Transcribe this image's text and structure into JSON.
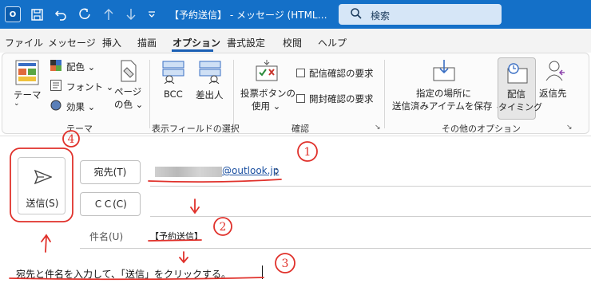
{
  "titlebar": {
    "logo": "O",
    "title": "【予約送信】 - メッセージ (HTML…",
    "search_label": "検索",
    "icons": [
      "app-logo",
      "save-icon",
      "undo-icon",
      "redo-icon",
      "up-arrow-icon",
      "down-arrow-icon",
      "dropdown-icon",
      "search-icon"
    ]
  },
  "menu": [
    "ファイル",
    "メッセージ",
    "挿入",
    "描画",
    "オプション",
    "書式設定",
    "校閲",
    "ヘルプ"
  ],
  "ribbon": {
    "theme": "テーマ",
    "colors": "配色",
    "fonts": "フォント",
    "effects": "効果",
    "page_color_1": "ページ",
    "page_color_2": "の色",
    "bcc": "BCC",
    "from": "差出人",
    "voting_1": "投票ボタンの",
    "voting_2": "使用",
    "delivery_receipt": "配信確認の要求",
    "read_receipt": "開封確認の要求",
    "save_sent_1": "指定の場所に",
    "save_sent_2": "送信済みアイテムを保存",
    "delay_1": "配信",
    "delay_2": "タイミング",
    "reply_to": "返信先",
    "groups": {
      "themes": "テーマ",
      "show_fields": "表示フィールドの選択",
      "tracking": "確認",
      "more_options": "その他のオプション"
    }
  },
  "compose": {
    "send_label": "送信(S)",
    "to_label": "宛先(T)",
    "cc_label": "ＣＣ(C)",
    "to_domain": "@outlook.jp",
    "to_separator": ";",
    "subject_label": "件名(U)",
    "subject_value": "【予約送信】",
    "body_text": "宛先と件名を入力して、「送信」をクリックする。"
  },
  "annotations": {
    "n1": "1",
    "n2": "2",
    "n3": "3",
    "n4": "4",
    "color": "#e0312b"
  }
}
